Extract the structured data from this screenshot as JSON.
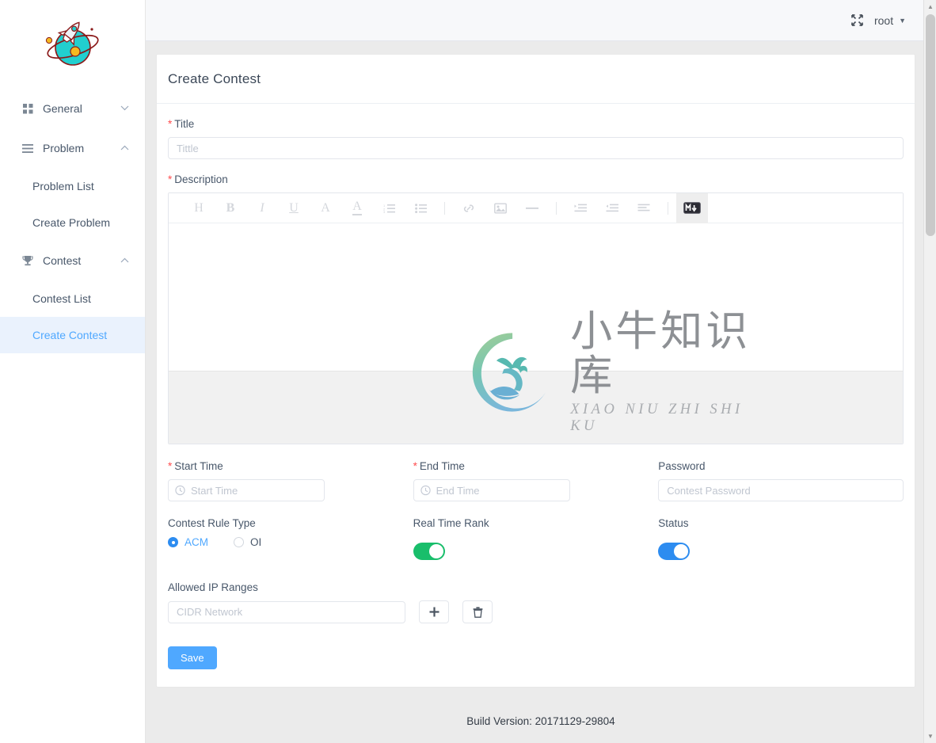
{
  "topbar": {
    "fullscreen_icon": "expand-arrows-icon",
    "username": "root",
    "caret": "▼"
  },
  "sidebar": {
    "logo_alt": "rocket-planet-logo",
    "groups": [
      {
        "label": "General",
        "icon": "grid-squares-icon",
        "caret": "⌄",
        "expanded": false,
        "items": []
      },
      {
        "label": "Problem",
        "icon": "list-lines-icon",
        "caret": "⌃",
        "expanded": true,
        "items": [
          {
            "label": "Problem List",
            "active": false
          },
          {
            "label": "Create Problem",
            "active": false
          }
        ]
      },
      {
        "label": "Contest",
        "icon": "trophy-icon",
        "caret": "⌃",
        "expanded": true,
        "items": [
          {
            "label": "Contest List",
            "active": false
          },
          {
            "label": "Create Contest",
            "active": true
          }
        ]
      }
    ]
  },
  "page": {
    "title": "Create Contest"
  },
  "form": {
    "title_label": "Title",
    "title_required": "*",
    "title_placeholder": "Tittle",
    "title_value": "",
    "description_label": "Description",
    "description_required": "*",
    "description_value": "",
    "start_time_label": "Start Time",
    "start_time_required": "*",
    "start_time_placeholder": "Start Time",
    "start_time_value": "",
    "end_time_label": "End Time",
    "end_time_required": "*",
    "end_time_placeholder": "End Time",
    "end_time_value": "",
    "password_label": "Password",
    "password_placeholder": "Contest Password",
    "password_value": "",
    "rule_type_label": "Contest Rule Type",
    "rule_options": [
      {
        "label": "ACM",
        "selected": true
      },
      {
        "label": "OI",
        "selected": false
      }
    ],
    "real_time_rank_label": "Real Time Rank",
    "real_time_rank_on": true,
    "status_label": "Status",
    "status_on": true,
    "ip_ranges_label": "Allowed IP Ranges",
    "ip_placeholder": "CIDR Network",
    "ip_value": "",
    "add_icon": "plus-icon",
    "delete_icon": "trash-icon",
    "save_label": "Save"
  },
  "editor": {
    "toolbar": [
      {
        "name": "heading-icon",
        "glyph": "H",
        "active": false
      },
      {
        "name": "bold-icon",
        "glyph": "B",
        "active": false
      },
      {
        "name": "italic-icon",
        "glyph": "I",
        "active": false
      },
      {
        "name": "underline-icon",
        "glyph": "U",
        "active": false
      },
      {
        "name": "font-size-icon",
        "glyph": "A",
        "active": false
      },
      {
        "name": "text-color-icon",
        "glyph": "A",
        "active": false
      },
      {
        "name": "ordered-list-icon",
        "glyph": "",
        "active": false
      },
      {
        "name": "unordered-list-icon",
        "glyph": "",
        "active": false
      },
      {
        "name": "separator",
        "glyph": "",
        "active": false
      },
      {
        "name": "link-icon",
        "glyph": "",
        "active": false
      },
      {
        "name": "image-icon",
        "glyph": "",
        "active": false
      },
      {
        "name": "horizontal-rule-icon",
        "glyph": "",
        "active": false
      },
      {
        "name": "separator",
        "glyph": "",
        "active": false
      },
      {
        "name": "indent-icon",
        "glyph": "",
        "active": false
      },
      {
        "name": "outdent-icon",
        "glyph": "",
        "active": false
      },
      {
        "name": "align-icon",
        "glyph": "",
        "active": false
      },
      {
        "name": "separator",
        "glyph": "",
        "active": false
      },
      {
        "name": "markdown-icon",
        "glyph": "M",
        "active": true
      }
    ]
  },
  "watermark": {
    "logo": "ox-head-circle-logo",
    "chinese": "小牛知识库",
    "pinyin": "XIAO NIU ZHI SHI KU"
  },
  "footer": {
    "build_version": "Build Version: 20171129-29804"
  },
  "colors": {
    "accent_blue": "#4fa8ff",
    "toggle_green": "#19be6b",
    "toggle_blue": "#2d8cf0",
    "required_red": "#ff4d4f",
    "active_bg": "#eaf2fd"
  }
}
